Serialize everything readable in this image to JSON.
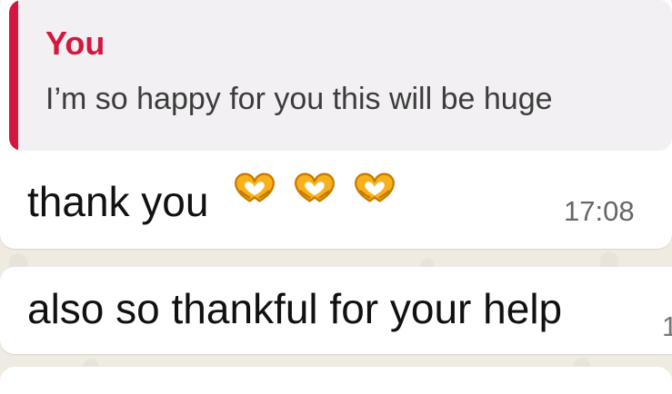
{
  "reply_preview": {
    "author": "You",
    "text": "I’m so happy for you this will be huge"
  },
  "messages": [
    {
      "text": "thank you",
      "emoji_icons": [
        "heart-hands-icon",
        "heart-hands-icon",
        "heart-hands-icon"
      ],
      "time": "17:08"
    },
    {
      "text": "also so thankful for your help",
      "time_fragment": "1"
    }
  ],
  "colors": {
    "background": "#efeae2",
    "bubble": "#ffffff",
    "quote_background": "#f2f0f2",
    "quote_accent": "#d4173f",
    "text": "#111111",
    "time": "#666666"
  }
}
